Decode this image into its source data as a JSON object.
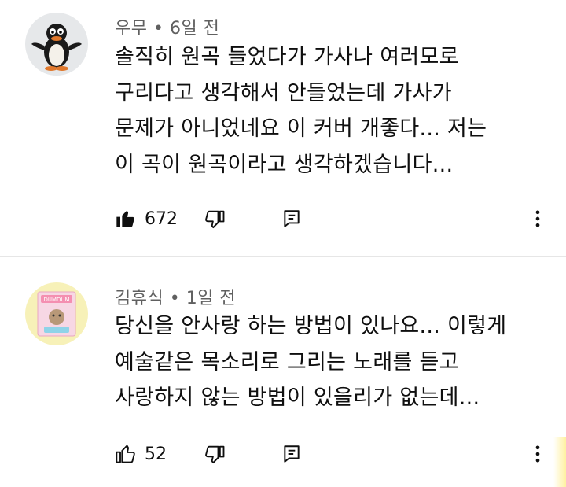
{
  "comments": [
    {
      "author": "우무",
      "time": "6일 전",
      "text": "솔직히 원곡 들었다가 가사나 여러모로\n구리다고 생각해서 안들었는데 가사가\n문제가 아니었네요 이 커버 개좋다... 저는\n이 곡이 원곡이라고 생각하겠습니다...",
      "likes": "672",
      "liked": true,
      "avatar_icon": "pingu-penguin-avatar"
    },
    {
      "author": "김휴식",
      "time": "1일 전",
      "text": "당신을 안사랑 하는 방법이 있나요... 이렇게\n예술같은 목소리로 그리는 노래를 듣고\n사랑하지 않는 방법이 있을리가 없는데...",
      "likes": "52",
      "liked": false,
      "avatar_icon": "album-cover-avatar",
      "avatar_text": "DUMDUM"
    }
  ],
  "separator": " • ",
  "icons": {
    "like": "thumbs-up-icon",
    "dislike": "thumbs-down-icon",
    "reply": "reply-icon",
    "more": "more-vertical-icon"
  },
  "colors": {
    "text": "#0f0f0f",
    "meta": "#606060",
    "divider": "#e6e6e6",
    "avatar1_bg": "#e6e8ea",
    "avatar2_bg": "#f7f1b8"
  }
}
